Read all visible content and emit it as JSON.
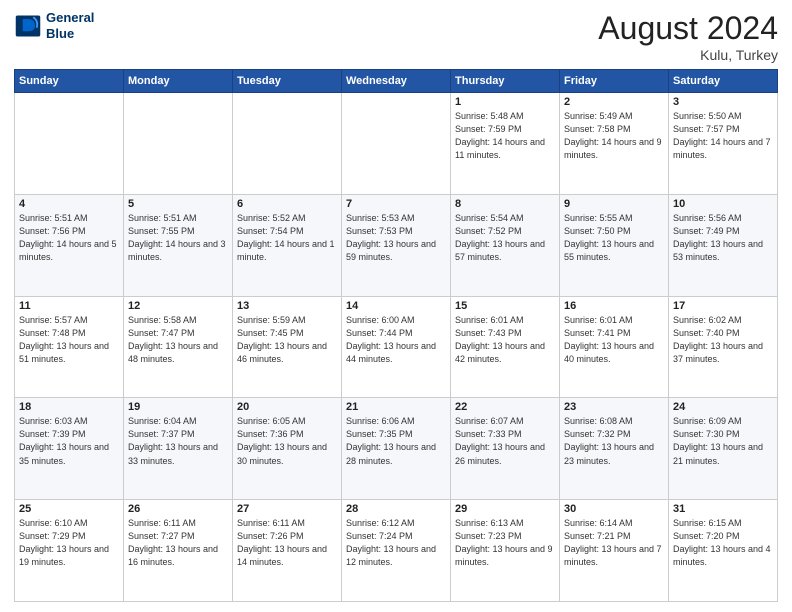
{
  "header": {
    "logo_line1": "General",
    "logo_line2": "Blue",
    "month_title": "August 2024",
    "location": "Kulu, Turkey"
  },
  "weekdays": [
    "Sunday",
    "Monday",
    "Tuesday",
    "Wednesday",
    "Thursday",
    "Friday",
    "Saturday"
  ],
  "weeks": [
    [
      {
        "day": "",
        "sunrise": "",
        "sunset": "",
        "daylight": ""
      },
      {
        "day": "",
        "sunrise": "",
        "sunset": "",
        "daylight": ""
      },
      {
        "day": "",
        "sunrise": "",
        "sunset": "",
        "daylight": ""
      },
      {
        "day": "",
        "sunrise": "",
        "sunset": "",
        "daylight": ""
      },
      {
        "day": "1",
        "sunrise": "Sunrise: 5:48 AM",
        "sunset": "Sunset: 7:59 PM",
        "daylight": "Daylight: 14 hours and 11 minutes."
      },
      {
        "day": "2",
        "sunrise": "Sunrise: 5:49 AM",
        "sunset": "Sunset: 7:58 PM",
        "daylight": "Daylight: 14 hours and 9 minutes."
      },
      {
        "day": "3",
        "sunrise": "Sunrise: 5:50 AM",
        "sunset": "Sunset: 7:57 PM",
        "daylight": "Daylight: 14 hours and 7 minutes."
      }
    ],
    [
      {
        "day": "4",
        "sunrise": "Sunrise: 5:51 AM",
        "sunset": "Sunset: 7:56 PM",
        "daylight": "Daylight: 14 hours and 5 minutes."
      },
      {
        "day": "5",
        "sunrise": "Sunrise: 5:51 AM",
        "sunset": "Sunset: 7:55 PM",
        "daylight": "Daylight: 14 hours and 3 minutes."
      },
      {
        "day": "6",
        "sunrise": "Sunrise: 5:52 AM",
        "sunset": "Sunset: 7:54 PM",
        "daylight": "Daylight: 14 hours and 1 minute."
      },
      {
        "day": "7",
        "sunrise": "Sunrise: 5:53 AM",
        "sunset": "Sunset: 7:53 PM",
        "daylight": "Daylight: 13 hours and 59 minutes."
      },
      {
        "day": "8",
        "sunrise": "Sunrise: 5:54 AM",
        "sunset": "Sunset: 7:52 PM",
        "daylight": "Daylight: 13 hours and 57 minutes."
      },
      {
        "day": "9",
        "sunrise": "Sunrise: 5:55 AM",
        "sunset": "Sunset: 7:50 PM",
        "daylight": "Daylight: 13 hours and 55 minutes."
      },
      {
        "day": "10",
        "sunrise": "Sunrise: 5:56 AM",
        "sunset": "Sunset: 7:49 PM",
        "daylight": "Daylight: 13 hours and 53 minutes."
      }
    ],
    [
      {
        "day": "11",
        "sunrise": "Sunrise: 5:57 AM",
        "sunset": "Sunset: 7:48 PM",
        "daylight": "Daylight: 13 hours and 51 minutes."
      },
      {
        "day": "12",
        "sunrise": "Sunrise: 5:58 AM",
        "sunset": "Sunset: 7:47 PM",
        "daylight": "Daylight: 13 hours and 48 minutes."
      },
      {
        "day": "13",
        "sunrise": "Sunrise: 5:59 AM",
        "sunset": "Sunset: 7:45 PM",
        "daylight": "Daylight: 13 hours and 46 minutes."
      },
      {
        "day": "14",
        "sunrise": "Sunrise: 6:00 AM",
        "sunset": "Sunset: 7:44 PM",
        "daylight": "Daylight: 13 hours and 44 minutes."
      },
      {
        "day": "15",
        "sunrise": "Sunrise: 6:01 AM",
        "sunset": "Sunset: 7:43 PM",
        "daylight": "Daylight: 13 hours and 42 minutes."
      },
      {
        "day": "16",
        "sunrise": "Sunrise: 6:01 AM",
        "sunset": "Sunset: 7:41 PM",
        "daylight": "Daylight: 13 hours and 40 minutes."
      },
      {
        "day": "17",
        "sunrise": "Sunrise: 6:02 AM",
        "sunset": "Sunset: 7:40 PM",
        "daylight": "Daylight: 13 hours and 37 minutes."
      }
    ],
    [
      {
        "day": "18",
        "sunrise": "Sunrise: 6:03 AM",
        "sunset": "Sunset: 7:39 PM",
        "daylight": "Daylight: 13 hours and 35 minutes."
      },
      {
        "day": "19",
        "sunrise": "Sunrise: 6:04 AM",
        "sunset": "Sunset: 7:37 PM",
        "daylight": "Daylight: 13 hours and 33 minutes."
      },
      {
        "day": "20",
        "sunrise": "Sunrise: 6:05 AM",
        "sunset": "Sunset: 7:36 PM",
        "daylight": "Daylight: 13 hours and 30 minutes."
      },
      {
        "day": "21",
        "sunrise": "Sunrise: 6:06 AM",
        "sunset": "Sunset: 7:35 PM",
        "daylight": "Daylight: 13 hours and 28 minutes."
      },
      {
        "day": "22",
        "sunrise": "Sunrise: 6:07 AM",
        "sunset": "Sunset: 7:33 PM",
        "daylight": "Daylight: 13 hours and 26 minutes."
      },
      {
        "day": "23",
        "sunrise": "Sunrise: 6:08 AM",
        "sunset": "Sunset: 7:32 PM",
        "daylight": "Daylight: 13 hours and 23 minutes."
      },
      {
        "day": "24",
        "sunrise": "Sunrise: 6:09 AM",
        "sunset": "Sunset: 7:30 PM",
        "daylight": "Daylight: 13 hours and 21 minutes."
      }
    ],
    [
      {
        "day": "25",
        "sunrise": "Sunrise: 6:10 AM",
        "sunset": "Sunset: 7:29 PM",
        "daylight": "Daylight: 13 hours and 19 minutes."
      },
      {
        "day": "26",
        "sunrise": "Sunrise: 6:11 AM",
        "sunset": "Sunset: 7:27 PM",
        "daylight": "Daylight: 13 hours and 16 minutes."
      },
      {
        "day": "27",
        "sunrise": "Sunrise: 6:11 AM",
        "sunset": "Sunset: 7:26 PM",
        "daylight": "Daylight: 13 hours and 14 minutes."
      },
      {
        "day": "28",
        "sunrise": "Sunrise: 6:12 AM",
        "sunset": "Sunset: 7:24 PM",
        "daylight": "Daylight: 13 hours and 12 minutes."
      },
      {
        "day": "29",
        "sunrise": "Sunrise: 6:13 AM",
        "sunset": "Sunset: 7:23 PM",
        "daylight": "Daylight: 13 hours and 9 minutes."
      },
      {
        "day": "30",
        "sunrise": "Sunrise: 6:14 AM",
        "sunset": "Sunset: 7:21 PM",
        "daylight": "Daylight: 13 hours and 7 minutes."
      },
      {
        "day": "31",
        "sunrise": "Sunrise: 6:15 AM",
        "sunset": "Sunset: 7:20 PM",
        "daylight": "Daylight: 13 hours and 4 minutes."
      }
    ]
  ]
}
